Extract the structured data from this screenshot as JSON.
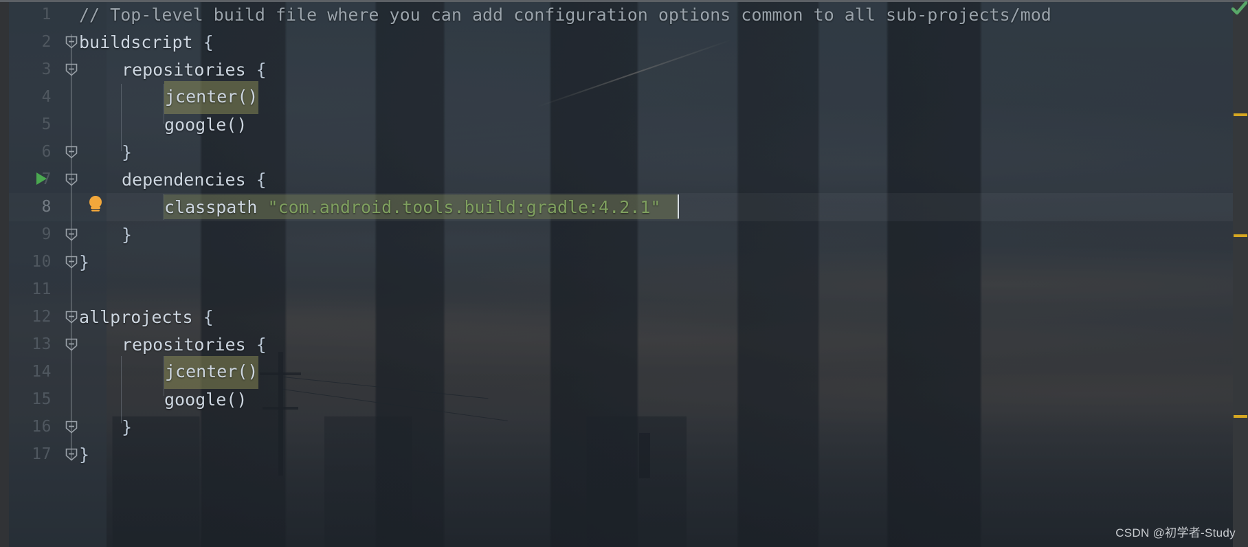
{
  "editor": {
    "font_size": 25,
    "line_height": 40,
    "theme": "darcula-with-wallpaper",
    "caret_line": 8,
    "colors": {
      "comment": "#9aa3ab",
      "string": "#7fa05f",
      "identifier": "#cdd6e0",
      "brace": "#b9c6d4",
      "line_number": "#787f86",
      "line_number_current": "#c6cdd4",
      "warning_stripe": "#d6a721",
      "run_marker": "#4aa850",
      "bulb": "#f2a73b",
      "inspection_ok": "#59a869",
      "search_highlight": "rgba(154,154,92,0.45)"
    }
  },
  "lines": [
    {
      "num": "1",
      "indent": 0,
      "tokens": [
        {
          "t": "comment",
          "v": "// Top-level build file where you can add configuration options common to all sub-projects/mod"
        }
      ]
    },
    {
      "num": "2",
      "indent": 0,
      "tokens": [
        {
          "t": "plain",
          "v": "buildscript "
        },
        {
          "t": "brace",
          "v": "{"
        }
      ]
    },
    {
      "num": "3",
      "indent": 1,
      "tokens": [
        {
          "t": "plain",
          "v": "repositories "
        },
        {
          "t": "brace",
          "v": "{"
        }
      ]
    },
    {
      "num": "4",
      "indent": 2,
      "tokens": [
        {
          "t": "hl",
          "v": "jcenter()"
        }
      ]
    },
    {
      "num": "5",
      "indent": 2,
      "tokens": [
        {
          "t": "plain",
          "v": "google()"
        }
      ]
    },
    {
      "num": "6",
      "indent": 1,
      "tokens": [
        {
          "t": "brace",
          "v": "}"
        }
      ]
    },
    {
      "num": "7",
      "indent": 1,
      "tokens": [
        {
          "t": "plain",
          "v": "dependencies "
        },
        {
          "t": "brace",
          "v": "{"
        }
      ]
    },
    {
      "num": "8",
      "indent": 2,
      "tokens": [
        {
          "t": "plain",
          "v": "classpath "
        },
        {
          "t": "string",
          "v": "\"com.android.tools.build:gradle:4.2.1\""
        }
      ]
    },
    {
      "num": "9",
      "indent": 1,
      "tokens": [
        {
          "t": "brace",
          "v": "}"
        }
      ]
    },
    {
      "num": "10",
      "indent": 0,
      "tokens": [
        {
          "t": "brace",
          "v": "}"
        }
      ]
    },
    {
      "num": "11",
      "indent": 0,
      "tokens": []
    },
    {
      "num": "12",
      "indent": 0,
      "tokens": [
        {
          "t": "plain",
          "v": "allprojects "
        },
        {
          "t": "brace",
          "v": "{"
        }
      ]
    },
    {
      "num": "13",
      "indent": 1,
      "tokens": [
        {
          "t": "plain",
          "v": "repositories "
        },
        {
          "t": "brace",
          "v": "{"
        }
      ]
    },
    {
      "num": "14",
      "indent": 2,
      "tokens": [
        {
          "t": "hl",
          "v": "jcenter()"
        }
      ]
    },
    {
      "num": "15",
      "indent": 2,
      "tokens": [
        {
          "t": "plain",
          "v": "google()"
        }
      ]
    },
    {
      "num": "16",
      "indent": 1,
      "tokens": [
        {
          "t": "brace",
          "v": "}"
        }
      ]
    },
    {
      "num": "17",
      "indent": 0,
      "tokens": [
        {
          "t": "brace",
          "v": "}"
        }
      ]
    }
  ],
  "gutter": {
    "fold_markers": [
      2,
      3,
      6,
      7,
      9,
      10,
      12,
      13,
      16,
      17
    ],
    "run_marker_line": 7,
    "bulb_line": 8,
    "run_marker_label": "run-gradle-task",
    "bulb_label": "show-intention-actions"
  },
  "stripe_gutter": {
    "marks": [
      {
        "line": 4,
        "severity": "warning",
        "color": "#d6a721"
      },
      {
        "line": 8,
        "severity": "warning",
        "color": "#d6a721"
      },
      {
        "line": 14,
        "severity": "warning",
        "color": "#d6a721"
      }
    ],
    "inspection_status": "ok"
  },
  "watermark": {
    "text": "CSDN @初学者-Study"
  }
}
